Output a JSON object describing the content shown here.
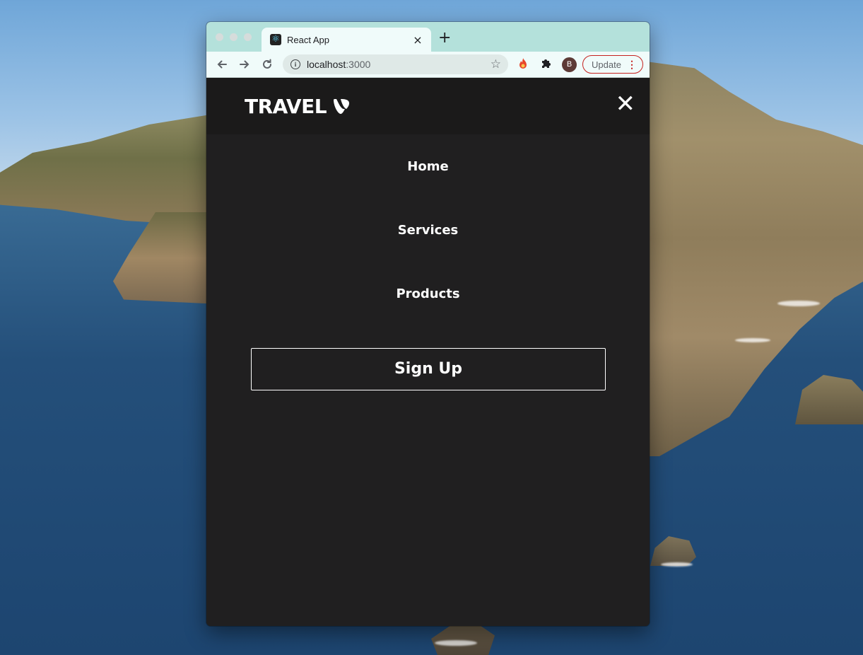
{
  "browser": {
    "tab_title": "React App",
    "tab_close": "×",
    "new_tab": "+",
    "url_host": "localhost",
    "url_port": ":3000",
    "avatar_letter": "B",
    "update_label": "Update",
    "update_menu": "⋮"
  },
  "site": {
    "logo_text": "TRAVEL",
    "close_icon": "✕",
    "menu": [
      "Home",
      "Services",
      "Products"
    ],
    "signup_label": "Sign Up"
  },
  "colors": {
    "tab_strip": "#b4e1db",
    "page_bg": "#201f20",
    "navbar_bg": "#1b1a1a",
    "update_accent": "#c5221f"
  }
}
